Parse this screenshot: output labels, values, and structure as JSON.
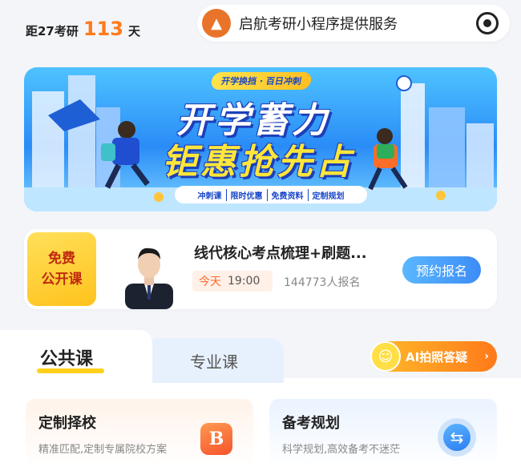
{
  "header": {
    "countdown_prefix": "距27考研",
    "countdown_days": "113",
    "countdown_suffix": "天",
    "miniprogram_title": "启航考研小程序提供服务"
  },
  "banner": {
    "badge": "开学换挡 · 百日冲刺",
    "headline_1": "开学蓄力",
    "headline_2": "钜惠抢先占",
    "tags": [
      "冲刺课",
      "限时优惠",
      "免费资料",
      "定制规划"
    ]
  },
  "live_course": {
    "badge_line1": "免费",
    "badge_line2": "公开课",
    "title": "线代核心考点梳理+刷题...",
    "day": "今天",
    "time": "19:00",
    "signups": "144773人报名",
    "reserve_label": "预约报名"
  },
  "tabs": {
    "public_label": "公共课",
    "major_label": "专业课",
    "ai_label": "AI拍照答疑"
  },
  "features": [
    {
      "title": "定制择校",
      "subtitle": "精准匹配,定制专属院校方案",
      "icon": "b-letter-icon"
    },
    {
      "title": "备考规划",
      "subtitle": "科学规划,高效备考不迷茫",
      "icon": "plan-icon"
    }
  ],
  "colors": {
    "accent_orange": "#ff7a1a",
    "primary_blue": "#3d8cf7",
    "badge_yellow": "#ffc21c"
  }
}
